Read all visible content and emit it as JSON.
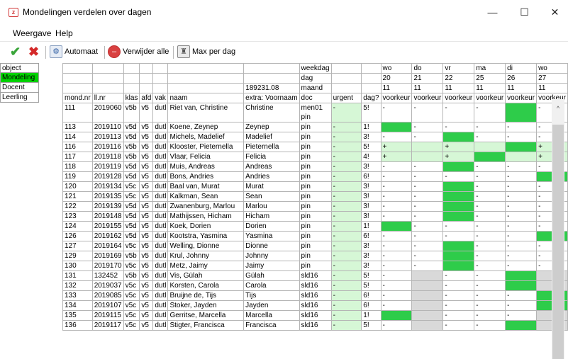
{
  "window": {
    "title": "Mondelingen verdelen over dagen",
    "minimize": "—",
    "maximize": "☐",
    "close": "✕"
  },
  "menu": [
    "Weergave",
    "Help"
  ],
  "toolbar": {
    "confirm_icon": "✔",
    "cancel_icon": "✖",
    "auto": "Automaat",
    "delete_all": "Verwijder alle",
    "max_per_day": "Max per dag"
  },
  "sidepanel": [
    {
      "label": "object",
      "active": false
    },
    {
      "label": "Mondeling",
      "active": true
    },
    {
      "label": "Docent",
      "active": false
    },
    {
      "label": "Leerling",
      "active": false
    }
  ],
  "colors": {
    "green": "#2ecc4a",
    "light_green": "#d6f7d6",
    "gray": "#d9d9d9",
    "active_side": "#00d100"
  },
  "header": {
    "weekdag_label": "weekdag",
    "dag_label": "dag",
    "maand_label": "maand",
    "extra_value": "189231.08",
    "weekdays": [
      "wo",
      "do",
      "vr",
      "ma",
      "di",
      "wo"
    ],
    "days": [
      "20",
      "21",
      "22",
      "25",
      "26",
      "27"
    ],
    "months": [
      "11",
      "11",
      "11",
      "11",
      "11",
      "11"
    ],
    "columns": [
      "mond.nr",
      "ll.nr",
      "klas",
      "afd",
      "vak",
      "naam",
      "extra: Voornaam",
      "doc",
      "urgent",
      "dag?",
      "voorkeur",
      "voorkeur",
      "voorkeur",
      "voorkeur",
      "voorkeur",
      "voorkeur"
    ]
  },
  "rows": [
    {
      "mond": "111",
      "ll": "2019060",
      "klas": "v5b",
      "afd": "v5",
      "vak": "dutl",
      "naam": "Riet van, Christine",
      "extra": "Christine",
      "doc": "men01\npin",
      "urgent": "-",
      "dag": "5!",
      "pref": [
        "-",
        "-",
        "-",
        "-",
        "",
        "-"
      ],
      "cls": [
        "",
        "",
        "",
        "",
        "g",
        ""
      ],
      "tall": true
    },
    {
      "mond": "113",
      "ll": "2019110",
      "klas": "v5d",
      "afd": "v5",
      "vak": "dutl",
      "naam": "Koene, Zeynep",
      "extra": "Zeynep",
      "doc": "pin",
      "urgent": "-",
      "dag": "1!",
      "pref": [
        "",
        "-",
        "-",
        "-",
        "-",
        "-"
      ],
      "cls": [
        "g",
        "",
        "",
        "",
        "",
        ""
      ]
    },
    {
      "mond": "114",
      "ll": "2019113",
      "klas": "v5d",
      "afd": "v5",
      "vak": "dutl",
      "naam": "Michels, Madelief",
      "extra": "Madelief",
      "doc": "pin",
      "urgent": "-",
      "dag": "3!",
      "pref": [
        "-",
        "-",
        "",
        "-",
        "-",
        "-"
      ],
      "cls": [
        "",
        "",
        "g",
        "",
        "",
        ""
      ]
    },
    {
      "mond": "116",
      "ll": "2019116",
      "klas": "v5b",
      "afd": "v5",
      "vak": "dutl",
      "naam": "Klooster, Pieternella",
      "extra": "Pieternella",
      "doc": "pin",
      "urgent": "-",
      "dag": "5!",
      "pref": [
        "+",
        "",
        "+",
        "",
        "",
        "+"
      ],
      "cls": [
        "l",
        "l",
        "l",
        "l",
        "g",
        "l"
      ]
    },
    {
      "mond": "117",
      "ll": "2019118",
      "klas": "v5b",
      "afd": "v5",
      "vak": "dutl",
      "naam": "Vlaar, Felicia",
      "extra": "Felicia",
      "doc": "pin",
      "urgent": "-",
      "dag": "4!",
      "pref": [
        "+",
        "",
        "+",
        "",
        "",
        "+"
      ],
      "cls": [
        "l",
        "l",
        "l",
        "g",
        "l",
        "l"
      ]
    },
    {
      "mond": "118",
      "ll": "2019119",
      "klas": "v5d",
      "afd": "v5",
      "vak": "dutl",
      "naam": "Muis, Andreas",
      "extra": "Andreas",
      "doc": "pin",
      "urgent": "-",
      "dag": "3!",
      "pref": [
        "-",
        "-",
        "",
        "-",
        "-",
        "-"
      ],
      "cls": [
        "",
        "",
        "g",
        "",
        "",
        ""
      ]
    },
    {
      "mond": "119",
      "ll": "2019128",
      "klas": "v5d",
      "afd": "v5",
      "vak": "dutl",
      "naam": "Bons, Andries",
      "extra": "Andries",
      "doc": "pin",
      "urgent": "-",
      "dag": "6!",
      "pref": [
        "-",
        "-",
        "-",
        "-",
        "-",
        ""
      ],
      "cls": [
        "",
        "",
        "",
        "",
        "",
        "g"
      ]
    },
    {
      "mond": "120",
      "ll": "2019134",
      "klas": "v5c",
      "afd": "v5",
      "vak": "dutl",
      "naam": "Baal van, Murat",
      "extra": "Murat",
      "doc": "pin",
      "urgent": "-",
      "dag": "3!",
      "pref": [
        "-",
        "-",
        "",
        "-",
        "-",
        "-"
      ],
      "cls": [
        "",
        "",
        "g",
        "",
        "",
        ""
      ]
    },
    {
      "mond": "121",
      "ll": "2019135",
      "klas": "v5c",
      "afd": "v5",
      "vak": "dutl",
      "naam": "Kalkman, Sean",
      "extra": "Sean",
      "doc": "pin",
      "urgent": "-",
      "dag": "3!",
      "pref": [
        "-",
        "-",
        "",
        "-",
        "-",
        "-"
      ],
      "cls": [
        "",
        "",
        "g",
        "",
        "",
        ""
      ]
    },
    {
      "mond": "122",
      "ll": "2019139",
      "klas": "v5d",
      "afd": "v5",
      "vak": "dutl",
      "naam": "Zwanenburg, Marlou",
      "extra": "Marlou",
      "doc": "pin",
      "urgent": "-",
      "dag": "3!",
      "pref": [
        "-",
        "-",
        "",
        "-",
        "-",
        "-"
      ],
      "cls": [
        "",
        "",
        "g",
        "",
        "",
        ""
      ]
    },
    {
      "mond": "123",
      "ll": "2019148",
      "klas": "v5d",
      "afd": "v5",
      "vak": "dutl",
      "naam": "Mathijssen, Hicham",
      "extra": "Hicham",
      "doc": "pin",
      "urgent": "-",
      "dag": "3!",
      "pref": [
        "-",
        "-",
        "",
        "-",
        "-",
        "-"
      ],
      "cls": [
        "",
        "",
        "g",
        "",
        "",
        ""
      ]
    },
    {
      "mond": "124",
      "ll": "2019155",
      "klas": "v5d",
      "afd": "v5",
      "vak": "dutl",
      "naam": "Koek, Dorien",
      "extra": "Dorien",
      "doc": "pin",
      "urgent": "-",
      "dag": "1!",
      "pref": [
        "",
        "-",
        "-",
        "-",
        "-",
        "-"
      ],
      "cls": [
        "g",
        "",
        "",
        "",
        "",
        ""
      ]
    },
    {
      "mond": "126",
      "ll": "2019162",
      "klas": "v5d",
      "afd": "v5",
      "vak": "dutl",
      "naam": "Kootstra, Yasmina",
      "extra": "Yasmina",
      "doc": "pin",
      "urgent": "-",
      "dag": "6!",
      "pref": [
        "-",
        "-",
        "-",
        "-",
        "-",
        ""
      ],
      "cls": [
        "",
        "",
        "",
        "",
        "",
        "g"
      ]
    },
    {
      "mond": "127",
      "ll": "2019164",
      "klas": "v5c",
      "afd": "v5",
      "vak": "dutl",
      "naam": "Welling, Dionne",
      "extra": "Dionne",
      "doc": "pin",
      "urgent": "-",
      "dag": "3!",
      "pref": [
        "-",
        "-",
        "",
        "-",
        "-",
        "-"
      ],
      "cls": [
        "",
        "",
        "g",
        "",
        "",
        ""
      ]
    },
    {
      "mond": "129",
      "ll": "2019169",
      "klas": "v5b",
      "afd": "v5",
      "vak": "dutl",
      "naam": "Krul, Johnny",
      "extra": "Johnny",
      "doc": "pin",
      "urgent": "-",
      "dag": "3!",
      "pref": [
        "-",
        "-",
        "",
        "-",
        "-",
        "-"
      ],
      "cls": [
        "",
        "",
        "g",
        "",
        "",
        ""
      ]
    },
    {
      "mond": "130",
      "ll": "2019170",
      "klas": "v5c",
      "afd": "v5",
      "vak": "dutl",
      "naam": "Metz, Jaimy",
      "extra": "Jaimy",
      "doc": "pin",
      "urgent": "-",
      "dag": "3!",
      "pref": [
        "-",
        "-",
        "",
        "-",
        "-",
        "-"
      ],
      "cls": [
        "",
        "",
        "g",
        "",
        "",
        ""
      ]
    },
    {
      "mond": "131",
      "ll": "132452",
      "klas": "v5b",
      "afd": "v5",
      "vak": "dutl",
      "naam": "Vis, Gülah",
      "extra": "Gülah",
      "doc": "sld16",
      "urgent": "-",
      "dag": "5!",
      "pref": [
        "-",
        "",
        "-",
        "-",
        "",
        ""
      ],
      "cls": [
        "",
        "x",
        "",
        "",
        "g",
        "x"
      ]
    },
    {
      "mond": "132",
      "ll": "2019037",
      "klas": "v5c",
      "afd": "v5",
      "vak": "dutl",
      "naam": "Korsten, Carola",
      "extra": "Carola",
      "doc": "sld16",
      "urgent": "-",
      "dag": "5!",
      "pref": [
        "-",
        "",
        "-",
        "-",
        "",
        ""
      ],
      "cls": [
        "",
        "x",
        "",
        "",
        "g",
        "x"
      ]
    },
    {
      "mond": "133",
      "ll": "2019085",
      "klas": "v5c",
      "afd": "v5",
      "vak": "dutl",
      "naam": "Bruijne de, Tijs",
      "extra": "Tijs",
      "doc": "sld16",
      "urgent": "-",
      "dag": "6!",
      "pref": [
        "-",
        "",
        "-",
        "-",
        "-",
        ""
      ],
      "cls": [
        "",
        "x",
        "",
        "",
        "",
        "g"
      ]
    },
    {
      "mond": "134",
      "ll": "2019107",
      "klas": "v5c",
      "afd": "v5",
      "vak": "dutl",
      "naam": "Stoker, Jayden",
      "extra": "Jayden",
      "doc": "sld16",
      "urgent": "-",
      "dag": "6!",
      "pref": [
        "-",
        "",
        "-",
        "-",
        "-",
        ""
      ],
      "cls": [
        "",
        "x",
        "",
        "",
        "",
        "g"
      ]
    },
    {
      "mond": "135",
      "ll": "2019115",
      "klas": "v5c",
      "afd": "v5",
      "vak": "dutl",
      "naam": "Gerritse, Marcella",
      "extra": "Marcella",
      "doc": "sld16",
      "urgent": "-",
      "dag": "1!",
      "pref": [
        "",
        "",
        "-",
        "-",
        "-",
        ""
      ],
      "cls": [
        "g",
        "x",
        "",
        "",
        "",
        "x"
      ]
    },
    {
      "mond": "136",
      "ll": "2019117",
      "klas": "v5c",
      "afd": "v5",
      "vak": "dutl",
      "naam": "Stigter, Francisca",
      "extra": "Francisca",
      "doc": "sld16",
      "urgent": "-",
      "dag": "5!",
      "pref": [
        "-",
        "",
        "-",
        "-",
        "",
        ""
      ],
      "cls": [
        "",
        "x",
        "",
        "",
        "g",
        "x"
      ]
    }
  ]
}
